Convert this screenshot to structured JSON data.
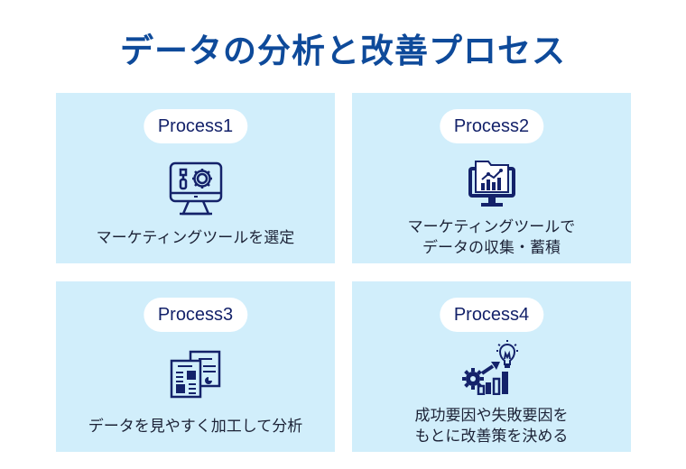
{
  "title": "データの分析と改善プロセス",
  "colors": {
    "title": "#0e4a9a",
    "card_bg": "#d1eefb",
    "pill_bg": "#ffffff",
    "pill_text": "#14226a",
    "icon": "#14226a",
    "body_text": "#1c2236"
  },
  "processes": [
    {
      "label": "Process1",
      "icon": "monitor-tools-gear-icon",
      "lines": [
        "マーケティングツールを選定"
      ]
    },
    {
      "label": "Process2",
      "icon": "monitor-folder-chart-icon",
      "lines": [
        "マーケティングツールで",
        "データの収集・蓄積"
      ]
    },
    {
      "label": "Process3",
      "icon": "documents-report-icon",
      "lines": [
        "データを見やすく加工して分析"
      ]
    },
    {
      "label": "Process4",
      "icon": "gear-growth-lightbulb-icon",
      "lines": [
        "成功要因や失敗要因を",
        "もとに改善策を決める"
      ]
    }
  ]
}
